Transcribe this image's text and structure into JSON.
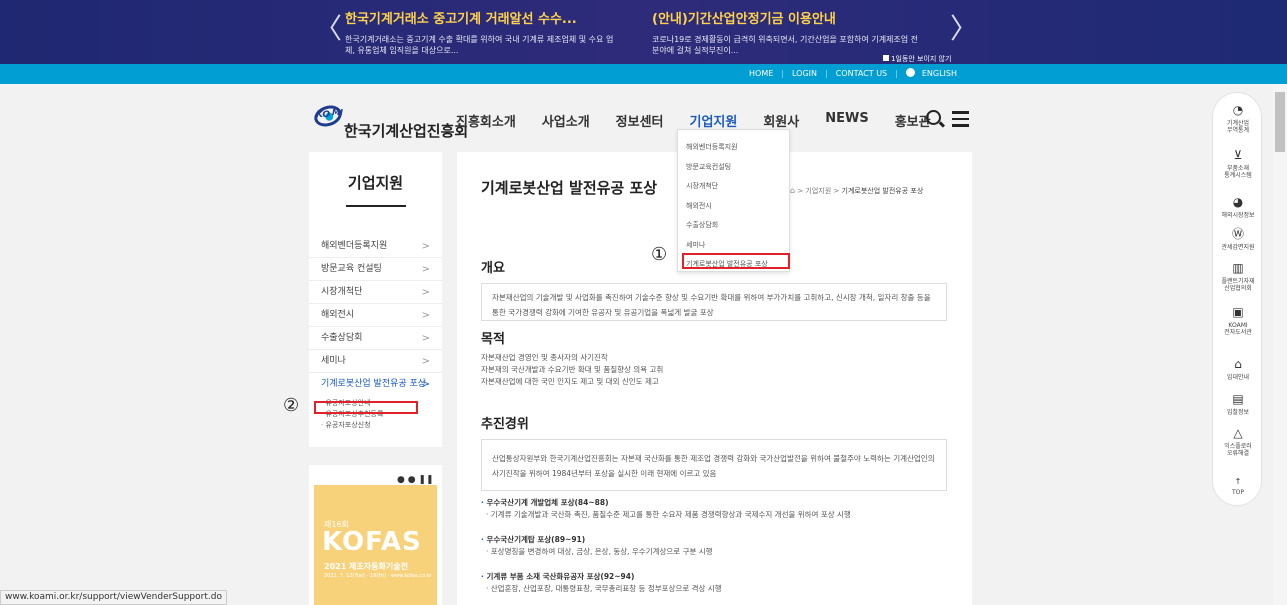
{
  "top_notice": {
    "prev_arrow": "〈",
    "next_arrow": "〉",
    "items": [
      {
        "title": "한국기계거래소 중고기계 거래알선 수수...",
        "desc": "한국기계거래소는 중고기계 수출 확대를 위하여 국내 기계류 제조업체 및 수요 업체, 유통업체 임직원을 대상으로..."
      },
      {
        "title": "(안내)기간산업안정기금 이용안내",
        "desc": "코로나19로 경제활동이 급격히 위축되면서, 기간산업을 포함하여 기계제조업 전분야에 걸쳐 실적부진이..."
      }
    ],
    "no_show_label": "1일동안 보이지 않기"
  },
  "util_links": {
    "home": "HOME",
    "login": "LOGIN",
    "contact": "CONTACT US",
    "english": "ENGLISH",
    "sep": "|"
  },
  "logo": {
    "ko": "KO",
    "mi": "MI",
    "name": "한국기계산업진흥회"
  },
  "gnb": [
    "진흥회소개",
    "사업소개",
    "정보센터",
    "기업지원",
    "회원사",
    "NEWS",
    "홍보관"
  ],
  "gnb_active": "기업지원",
  "dropdown": [
    "해외벤더등록지원",
    "방문교육컨설팅",
    "시장개척단",
    "해외전시",
    "수출상담회",
    "세미나",
    "기계로봇산업 발전유공 포상"
  ],
  "lnb": {
    "title": "기업지원",
    "items": [
      "해외벤더등록지원",
      "방문교육 컨설팅",
      "시장개척단",
      "해외전시",
      "수출상담회",
      "세미나",
      "기계로봇산업 발전유공 포상"
    ],
    "chevron": ">",
    "sub": [
      "유공자포상안내",
      "유공자포상추천등록",
      "유공자포상신청"
    ]
  },
  "poster": {
    "edition": "제16회",
    "name": "KOFAS",
    "subtitle": "2021 제조자동화기술전",
    "dates": "2021. 7. 13(Tue) - 16(Fri) · www.kofas.co.kr",
    "dots": "● ● ❚❚"
  },
  "content": {
    "title": "기계로봇산업 발전유공 포상",
    "breadcrumb": {
      "home": "⌂",
      "sep": ">",
      "level1": "기업지원",
      "current": "기계로봇산업 발전유공 포상"
    },
    "overview_title": "개요",
    "overview_text": "자본재산업의 기술개발 및 사업화를 촉진하여 기술수준 향상 및 수요기반 확대를 위하여 부가가치를 고취하고, 신시장 개척, 일자리 창출 등을 통한 국가경쟁력 강화에 기여한 유공자 및 유공기업을 폭넓게 발굴 포상",
    "purpose_title": "목적",
    "purpose_lines": [
      "자본재산업 경영인 및 종사자의 사기진작",
      "자본재의 국산개발과 수요기반 확대 및 품질향상 의욕 고취",
      "자본재산업에 대한 국민 인지도 제고 및 대외 신인도 제고"
    ],
    "history_title": "추진경위",
    "history_text": "산업통상자원부와 한국기계산업진흥회는 자본재 국산화를 통한 제조업 경쟁력 강화와 국가산업발전을 위하여 불철주야 노력하는 기계산업인의 사기진작을 위하여 1984년부터 포상을 실시한 이래 현재에 이르고 있음",
    "history_items": [
      {
        "title": "우수국산기계 개발업체 포상(84~88)",
        "desc": "· 기계류 기술개발과 국산화 촉진, 품질수준 제고를 통한 수요자 제품 경쟁력향상과 국제수지 개선을 위하여 포상 시행"
      },
      {
        "title": "우수국산기계탑 포상(89~91)",
        "desc": "· 포상명칭을 변경하여 대상, 금상, 은상, 동상, 우수기계상으로 구분 시행"
      },
      {
        "title": "기계류 부품 소재 국산화유공자 포상(92~94)",
        "desc": "· 산업훈장, 산업포장, 대통령표창, 국무총리표창 등 정부포상으로 격상 시행"
      }
    ]
  },
  "annotations": {
    "one": "①",
    "two": "②"
  },
  "quick_menu": [
    {
      "icon": "◔",
      "label": "기계산업\n무역통계"
    },
    {
      "icon": "⊻",
      "label": "부품소재\n통계시스템"
    },
    {
      "icon": "◕",
      "label": "해외시장정보"
    },
    {
      "icon": "Ⓦ",
      "label": "관세감면지원"
    },
    {
      "icon": "▥",
      "label": "플랜트기자재\n산업협의회"
    },
    {
      "icon": "▣",
      "label": "KOAMI\n전자도서관"
    },
    {
      "icon": "⌂",
      "label": "임대안내"
    },
    {
      "icon": "▤",
      "label": "입찰정보"
    },
    {
      "icon": "△",
      "label": "익스플로러\n오류해결"
    },
    {
      "icon": "↑",
      "label": "TOP"
    }
  ],
  "status_url": "www.koami.or.kr/support/viewVenderSupport.do",
  "colors": {
    "banner": "#1f2872",
    "util_bar": "#009ed3",
    "accent_blue": "#1a5bbf",
    "highlight_red": "#e3212b",
    "notice_title": "#ffd24a"
  }
}
